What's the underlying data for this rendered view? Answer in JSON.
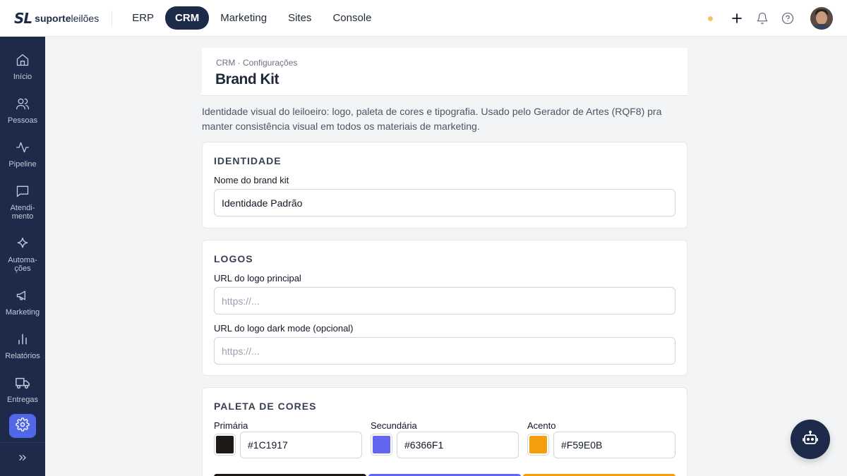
{
  "brand": {
    "logo_mark": "SL",
    "logo_text_bold": "suporte",
    "logo_text_light": "leilões"
  },
  "top_nav": [
    {
      "label": "ERP",
      "active": false
    },
    {
      "label": "CRM",
      "active": true
    },
    {
      "label": "Marketing",
      "active": false
    },
    {
      "label": "Sites",
      "active": false
    },
    {
      "label": "Console",
      "active": false
    }
  ],
  "top_actions": {
    "status_color": "#f5c26b",
    "icons": [
      "plus-icon",
      "bell-icon",
      "help-icon"
    ]
  },
  "sidebar": {
    "items": [
      {
        "label": "Início",
        "icon": "home-icon"
      },
      {
        "label": "Pessoas",
        "icon": "users-icon"
      },
      {
        "label": "Pipeline",
        "icon": "activity-icon"
      },
      {
        "label": "Atendi-\nmento",
        "icon": "chat-icon"
      },
      {
        "label": "Automa-\nções",
        "icon": "sparkle-icon"
      },
      {
        "label": "Marketing",
        "icon": "megaphone-icon"
      },
      {
        "label": "Relatórios",
        "icon": "bar-chart-icon"
      },
      {
        "label": "Entregas",
        "icon": "truck-icon"
      }
    ],
    "active_icon": "gear-icon",
    "footer_icon": "chevrons-right-icon"
  },
  "header": {
    "breadcrumb": "CRM · Configurações",
    "title": "Brand Kit"
  },
  "description": "Identidade visual do leiloeiro: logo, paleta de cores e tipografia. Usado pelo Gerador de Artes (RQF8) pra manter consistência visual em todos os materiais de marketing.",
  "identity": {
    "title": "IDENTIDADE",
    "name_label": "Nome do brand kit",
    "name_value": "Identidade Padrão"
  },
  "logos": {
    "title": "LOGOS",
    "main_label": "URL do logo principal",
    "main_placeholder": "https://...",
    "dark_label": "URL do logo dark mode (opcional)",
    "dark_placeholder": "https://..."
  },
  "palette": {
    "title": "PALETA DE CORES",
    "colors": [
      {
        "label": "Primária",
        "hex": "#1C1917",
        "swatch": "#1c1917"
      },
      {
        "label": "Secundária",
        "hex": "#6366F1",
        "swatch": "#6366f1"
      },
      {
        "label": "Acento",
        "hex": "#F59E0B",
        "swatch": "#f59e0b"
      }
    ]
  },
  "accent_colors": {
    "navy": "#1e2a4a",
    "active_blue": "#4f67e8"
  }
}
